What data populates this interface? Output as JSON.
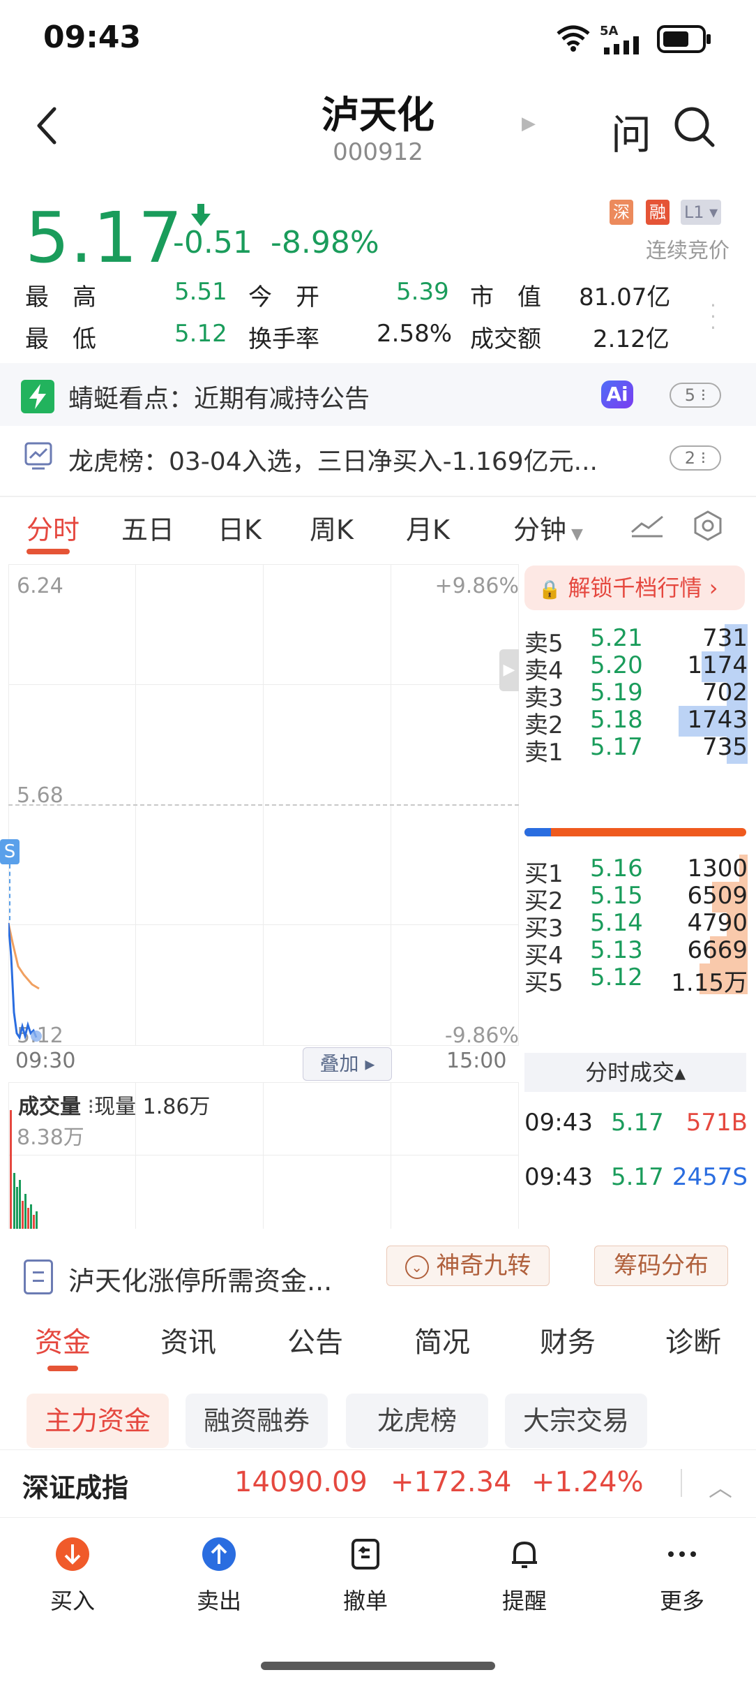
{
  "status": {
    "time": "09:43",
    "network": "5A"
  },
  "header": {
    "title": "泸天化",
    "code": "000912",
    "ask_label": "问"
  },
  "quote": {
    "price": "5.17",
    "change": "-0.51",
    "change_pct": "-8.98%",
    "tags": [
      "深",
      "融",
      "L1"
    ],
    "trade_mode": "连续竞价",
    "stats": [
      {
        "label": "最　高",
        "value": "5.51"
      },
      {
        "label": "今　开",
        "value": "5.39"
      },
      {
        "label": "市　值",
        "value": "81.07亿"
      },
      {
        "label": "最　低",
        "value": "5.12"
      },
      {
        "label": "换手率",
        "value": "2.58%"
      },
      {
        "label": "成交额",
        "value": "2.12亿"
      }
    ]
  },
  "news": [
    {
      "text": "蜻蜓看点：近期有减持公告",
      "count": "5",
      "ai": "Ai"
    },
    {
      "text": "龙虎榜：03-04入选，三日净买入-1.169亿元...",
      "count": "2"
    }
  ],
  "chart_tabs": [
    "分时",
    "五日",
    "日K",
    "周K",
    "月K",
    "分钟"
  ],
  "chart": {
    "y_top": "6.24",
    "y_mid": "5.68",
    "y_bottom": "5.12",
    "pct_top": "+9.86%",
    "pct_bottom": "-9.86%",
    "time_start": "09:30",
    "time_end": "15:00",
    "overlay_label": "叠加",
    "marker": "S",
    "volume_title": "成交量",
    "volume_now": "现量 1.86万",
    "volume_max": "8.38万"
  },
  "order_book": {
    "unlock_label": "解锁千档行情",
    "asks": [
      {
        "label": "卖5",
        "price": "5.21",
        "vol": "731",
        "fill": 0.11
      },
      {
        "label": "卖4",
        "price": "5.20",
        "vol": "1174",
        "fill": 0.22
      },
      {
        "label": "卖3",
        "price": "5.19",
        "vol": "702",
        "fill": 0.1
      },
      {
        "label": "卖2",
        "price": "5.18",
        "vol": "1743",
        "fill": 0.33
      },
      {
        "label": "卖1",
        "price": "5.17",
        "vol": "735",
        "fill": 0.1
      }
    ],
    "bids": [
      {
        "label": "买1",
        "price": "5.16",
        "vol": "1300",
        "fill": 0.04
      },
      {
        "label": "买2",
        "price": "5.15",
        "vol": "6509",
        "fill": 0.17
      },
      {
        "label": "买3",
        "price": "5.14",
        "vol": "4790",
        "fill": 0.1
      },
      {
        "label": "买4",
        "price": "5.13",
        "vol": "6669",
        "fill": 0.18
      },
      {
        "label": "买5",
        "price": "5.12",
        "vol": "1.15万",
        "fill": 0.23
      }
    ],
    "ticks_header": "分时成交",
    "ticks": [
      {
        "time": "09:43",
        "price": "5.17",
        "vol": "571B",
        "color": "#e5483f"
      },
      {
        "time": "09:43",
        "price": "5.17",
        "vol": "2457S",
        "color": "#2a6de0"
      }
    ]
  },
  "features": {
    "link_text": "泸天化涨停所需资金...",
    "magic": "神奇九转",
    "chips": "筹码分布"
  },
  "info_tabs": [
    "资金",
    "资讯",
    "公告",
    "简况",
    "财务",
    "诊断"
  ],
  "sub_tabs": [
    "主力资金",
    "融资融券",
    "龙虎榜",
    "大宗交易"
  ],
  "index": {
    "name": "深证成指",
    "value": "14090.09",
    "change": "+172.34",
    "pct": "+1.24%"
  },
  "nav": [
    "买入",
    "卖出",
    "撤单",
    "提醒",
    "更多"
  ],
  "colors": {
    "down": "#1a9c5b",
    "up": "#e5483f",
    "accent": "#e5483f",
    "ask_bar": "#bcd3f5",
    "bid_bar": "#f9c9ab"
  }
}
